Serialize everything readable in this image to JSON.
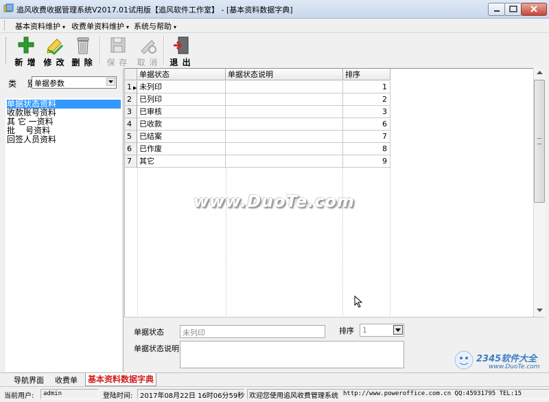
{
  "window": {
    "title": "追风收费收据管理系统V2017.01试用版【追风软件工作室】 - [基本资料数据字典]"
  },
  "menu": {
    "items": [
      {
        "label": "基本资料维护"
      },
      {
        "label": "收费单资料维护"
      },
      {
        "label": "系统与帮助"
      }
    ],
    "arrow": "▾"
  },
  "toolbar": {
    "new_label": "新 增",
    "edit_label": "修 改",
    "delete_label": "删 除",
    "save_label": "保 存",
    "cancel_label": "取 消",
    "exit_label": "退 出",
    "colors": {
      "new": "#2e9d2e",
      "edit": "#c8a417",
      "exit": "#c02b2b"
    }
  },
  "left": {
    "category_label": "类 别",
    "category_value": "单据参数",
    "items": [
      "单据状态资料",
      "收款账号资料",
      "其 它 一资料",
      "批    号资料",
      "回签人员资料"
    ],
    "selected_index": 0,
    "selection_color": "#3399ff"
  },
  "grid": {
    "columns": [
      "单据状态",
      "单据状态说明",
      "排序"
    ],
    "rows": [
      {
        "no": "1",
        "status": "未列印",
        "desc": "",
        "order": "1"
      },
      {
        "no": "2",
        "status": "已列印",
        "desc": "",
        "order": "2"
      },
      {
        "no": "3",
        "status": "已审核",
        "desc": "",
        "order": "3"
      },
      {
        "no": "4",
        "status": "已收款",
        "desc": "",
        "order": "6"
      },
      {
        "no": "5",
        "status": "已结案",
        "desc": "",
        "order": "7"
      },
      {
        "no": "6",
        "status": "已作废",
        "desc": "",
        "order": "8"
      },
      {
        "no": "7",
        "status": "其它",
        "desc": "",
        "order": "9"
      }
    ],
    "current_row_marker": "▶"
  },
  "form": {
    "status_label": "单据状态",
    "status_value": "未列印",
    "order_label": "排序",
    "order_value": "1",
    "desc_label": "单据状态说明",
    "desc_value": ""
  },
  "tabs": {
    "items": [
      "导航界面",
      "收费单"
    ],
    "active": "基本资料数据字典",
    "active_color": "#d21c1c"
  },
  "status": {
    "user_label": "当前用户:",
    "user_value": "admin",
    "login_label": "登陆时间:",
    "login_value": "2017年08月22日  16时06分59秒",
    "welcome": "欢迎您使用追风收费管理系统",
    "contact": "http://www.poweroffice.com.cn  QQ:45931795 TEL:15"
  },
  "watermarks": {
    "duote": "www.DuoTe.com",
    "site2345": "2345软件大全",
    "site2345_url": "www.DuoTe.com"
  }
}
